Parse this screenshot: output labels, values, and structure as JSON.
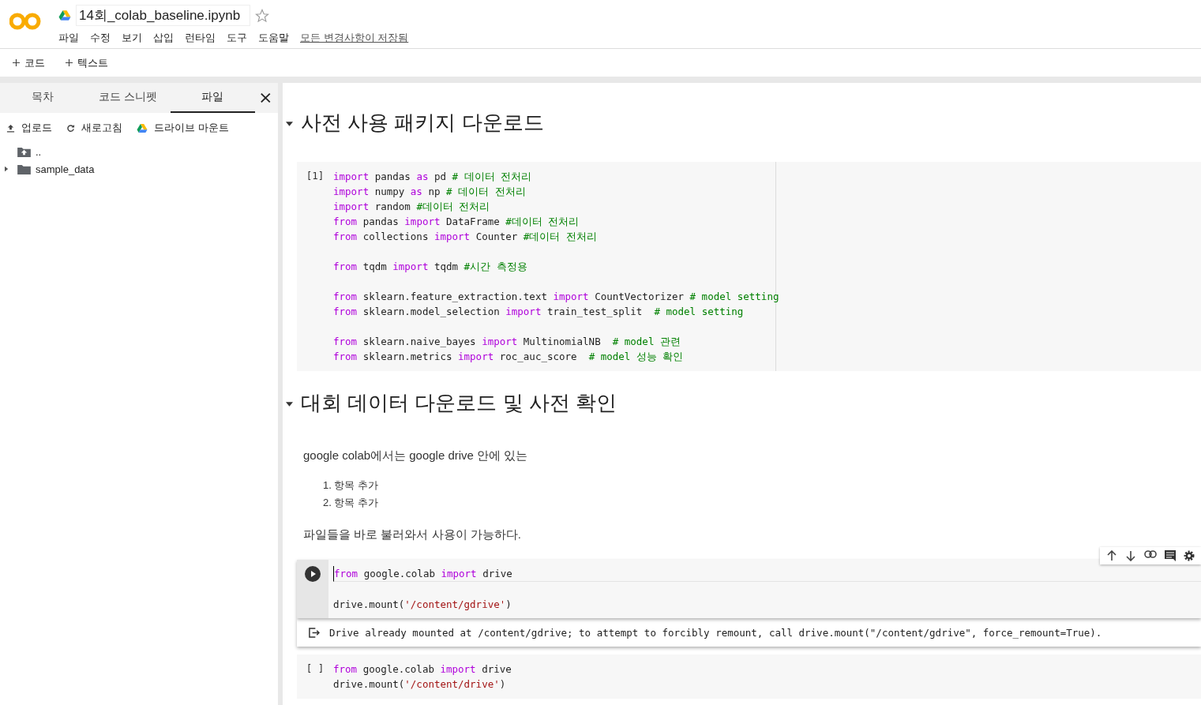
{
  "header": {
    "file_name": "14회_colab_baseline.ipynb",
    "starred": false,
    "menu": [
      "파일",
      "수정",
      "보기",
      "삽입",
      "런타임",
      "도구",
      "도움말"
    ],
    "save_status": "모든 변경사항이 저장됨"
  },
  "toolbar": [
    {
      "label": "코드"
    },
    {
      "label": "텍스트"
    }
  ],
  "sidebar": {
    "tabs": [
      {
        "label": "목차",
        "selected": false
      },
      {
        "label": "코드 스니펫",
        "selected": false
      },
      {
        "label": "파일",
        "selected": true
      }
    ],
    "actions": [
      {
        "kind": "upload",
        "label": "업로드"
      },
      {
        "kind": "refresh",
        "label": "새로고침"
      },
      {
        "kind": "drive",
        "label": "드라이브 마운트"
      }
    ],
    "files": [
      {
        "kind": "parent",
        "name": ".."
      },
      {
        "kind": "folder",
        "name": "sample_data",
        "expanded": false
      }
    ]
  },
  "cells": [
    {
      "kind": "heading",
      "text": "사전 사용 패키지 다운로드",
      "expanded": true
    },
    {
      "kind": "code",
      "exec_label": "[1]",
      "active": false,
      "blocks": [
        [
          [
            {
              "kind": "kw",
              "text": "import"
            },
            {
              "kind": "id",
              "text": " pandas "
            },
            {
              "kind": "kw",
              "text": "as"
            },
            {
              "kind": "id",
              "text": " pd "
            },
            {
              "kind": "cm",
              "text": "# 데이터 전처리"
            }
          ],
          [
            {
              "kind": "kw",
              "text": "import"
            },
            {
              "kind": "id",
              "text": " numpy "
            },
            {
              "kind": "kw",
              "text": "as"
            },
            {
              "kind": "id",
              "text": " np "
            },
            {
              "kind": "cm",
              "text": "# 데이터 전처리"
            }
          ],
          [
            {
              "kind": "kw",
              "text": "import"
            },
            {
              "kind": "id",
              "text": " random "
            },
            {
              "kind": "cm",
              "text": "#데이터 전처리"
            }
          ],
          [
            {
              "kind": "kw",
              "text": "from"
            },
            {
              "kind": "id",
              "text": " pandas "
            },
            {
              "kind": "kw",
              "text": "import"
            },
            {
              "kind": "id",
              "text": " DataFrame "
            },
            {
              "kind": "cm",
              "text": "#데이터 전처리"
            }
          ],
          [
            {
              "kind": "kw",
              "text": "from"
            },
            {
              "kind": "id",
              "text": " collections "
            },
            {
              "kind": "kw",
              "text": "import"
            },
            {
              "kind": "id",
              "text": " Counter "
            },
            {
              "kind": "cm",
              "text": "#데이터 전처리"
            }
          ]
        ],
        [
          [
            {
              "kind": "kw",
              "text": "from"
            },
            {
              "kind": "id",
              "text": " tqdm "
            },
            {
              "kind": "kw",
              "text": "import"
            },
            {
              "kind": "id",
              "text": " tqdm "
            },
            {
              "kind": "cm",
              "text": "#시간 측정용"
            }
          ]
        ],
        [
          [
            {
              "kind": "kw",
              "text": "from"
            },
            {
              "kind": "id",
              "text": " sklearn.feature_extraction.text "
            },
            {
              "kind": "kw",
              "text": "import"
            },
            {
              "kind": "id",
              "text": " CountVectorizer "
            },
            {
              "kind": "cm",
              "text": "# model setting"
            }
          ],
          [
            {
              "kind": "kw",
              "text": "from"
            },
            {
              "kind": "id",
              "text": " sklearn.model_selection "
            },
            {
              "kind": "kw",
              "text": "import"
            },
            {
              "kind": "id",
              "text": " train_test_split  "
            },
            {
              "kind": "cm",
              "text": "# model setting"
            }
          ]
        ],
        [
          [
            {
              "kind": "kw",
              "text": "from"
            },
            {
              "kind": "id",
              "text": " sklearn.naive_bayes "
            },
            {
              "kind": "kw",
              "text": "import"
            },
            {
              "kind": "id",
              "text": " MultinomialNB  "
            },
            {
              "kind": "cm",
              "text": "# model 관련"
            }
          ],
          [
            {
              "kind": "kw",
              "text": "from"
            },
            {
              "kind": "id",
              "text": " sklearn.metrics "
            },
            {
              "kind": "kw",
              "text": "import"
            },
            {
              "kind": "id",
              "text": " roc_auc_score  "
            },
            {
              "kind": "cm",
              "text": "# model 성능 확인"
            }
          ]
        ]
      ]
    },
    {
      "kind": "heading",
      "text": "대회 데이터 다운로드 및 사전 확인",
      "expanded": true
    },
    {
      "kind": "text",
      "paragraphs": [
        "google colab에서는 google drive 안에 있는"
      ],
      "list": [
        {
          "number": "1.",
          "text": "항목 추가"
        },
        {
          "number": "2.",
          "text": "항목 추가"
        }
      ],
      "closing": "파일들을 바로 불러와서 사용이 가능하다."
    },
    {
      "kind": "code",
      "active": true,
      "blocks": [
        [
          [
            {
              "kind": "kw",
              "text": "from"
            },
            {
              "kind": "id",
              "text": " google.colab "
            },
            {
              "kind": "kw",
              "text": "import"
            },
            {
              "kind": "id",
              "text": " drive"
            }
          ]
        ],
        [
          [
            {
              "kind": "id",
              "text": "drive.mount("
            },
            {
              "kind": "str",
              "text": "'/content/gdrive'"
            },
            {
              "kind": "id",
              "text": ")"
            }
          ]
        ]
      ],
      "output": "Drive already mounted at /content/gdrive; to attempt to forcibly remount, call drive.mount(\"/content/gdrive\", force_remount=True)."
    },
    {
      "kind": "code",
      "exec_label": "[ ]",
      "active": false,
      "blocks": [
        [
          [
            {
              "kind": "kw",
              "text": "from"
            },
            {
              "kind": "id",
              "text": " google.colab "
            },
            {
              "kind": "kw",
              "text": "import"
            },
            {
              "kind": "id",
              "text": " drive"
            }
          ],
          [
            {
              "kind": "id",
              "text": "drive.mount("
            },
            {
              "kind": "str",
              "text": "'/content/drive'"
            },
            {
              "kind": "id",
              "text": ")"
            }
          ]
        ]
      ]
    }
  ]
}
